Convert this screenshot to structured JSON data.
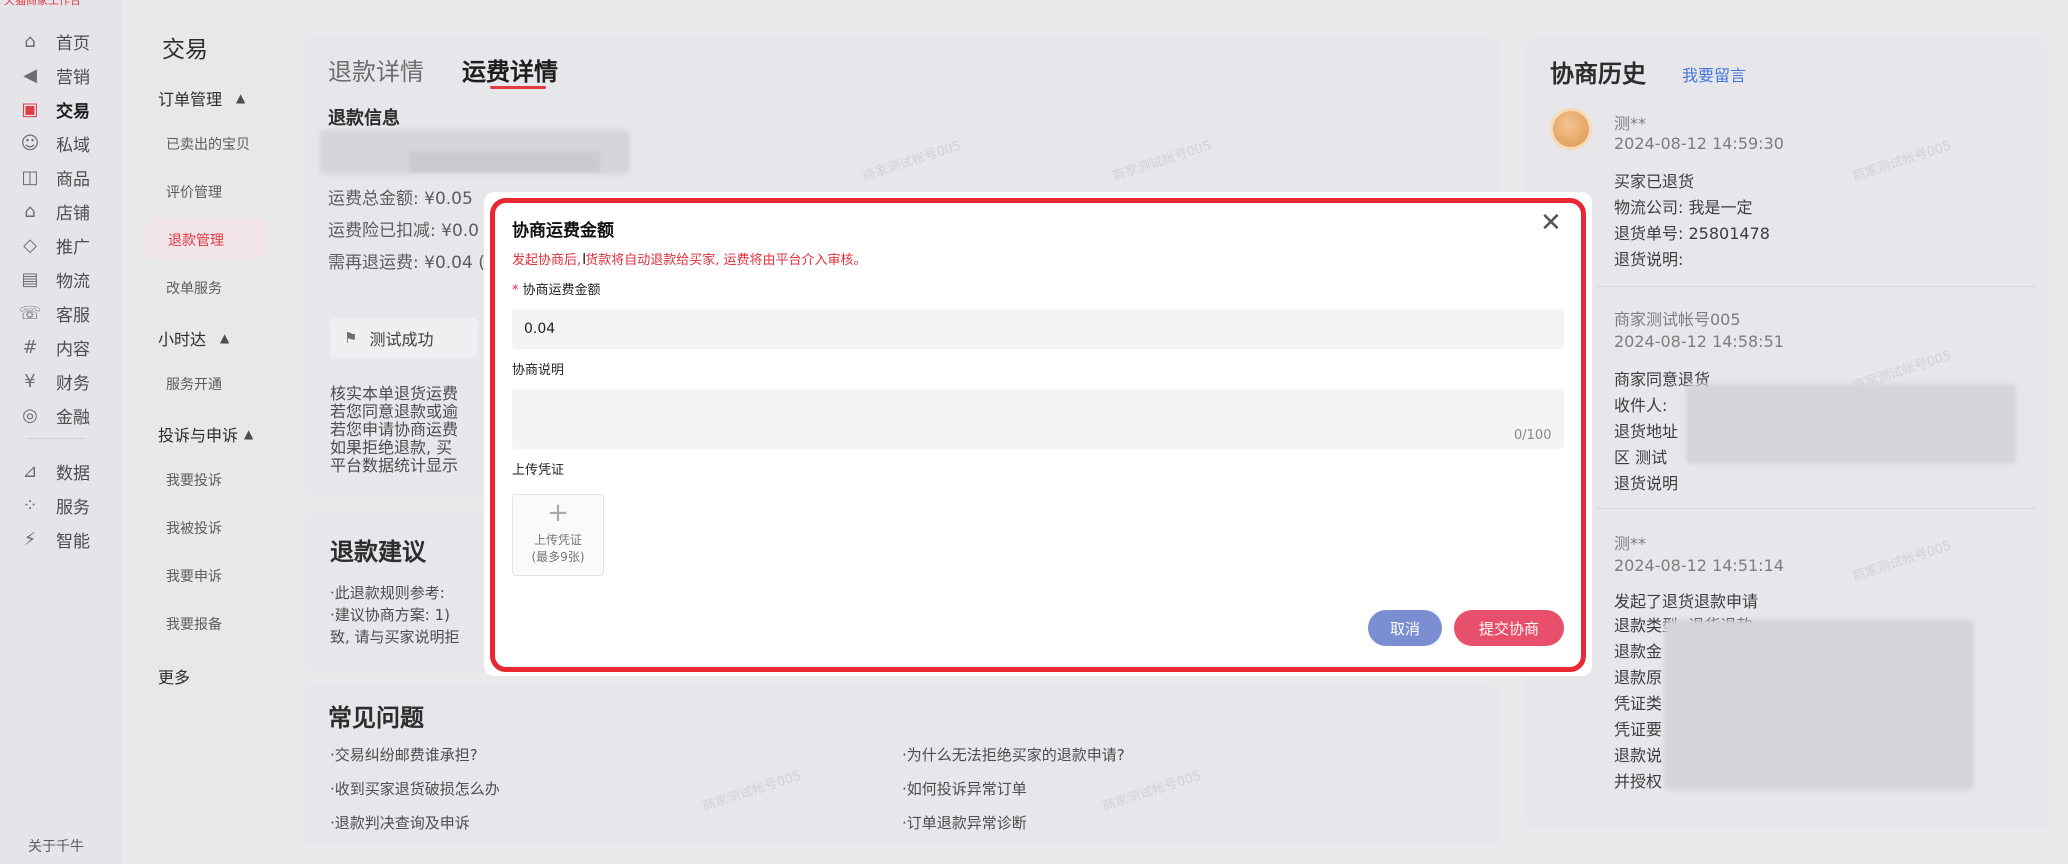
{
  "nav": {
    "top_text": "天猫商家工作台",
    "items": [
      {
        "label": "首页",
        "icon": "home-icon",
        "glyph": "⌂"
      },
      {
        "label": "营销",
        "icon": "megaphone-icon",
        "glyph": "📢"
      },
      {
        "label": "交易",
        "icon": "trade-icon",
        "glyph": "▣"
      },
      {
        "label": "私域",
        "icon": "people-icon",
        "glyph": "☺"
      },
      {
        "label": "商品",
        "icon": "product-icon",
        "glyph": "◫"
      },
      {
        "label": "店铺",
        "icon": "shop-icon",
        "glyph": "⌂"
      },
      {
        "label": "推广",
        "icon": "promote-icon",
        "glyph": "◇"
      },
      {
        "label": "物流",
        "icon": "truck-icon",
        "glyph": "⛟"
      },
      {
        "label": "客服",
        "icon": "headset-icon",
        "glyph": "☏"
      },
      {
        "label": "内容",
        "icon": "content-icon",
        "glyph": "#"
      },
      {
        "label": "财务",
        "icon": "yen-icon",
        "glyph": "¥"
      },
      {
        "label": "金融",
        "icon": "finance-icon",
        "glyph": "◎"
      },
      {
        "label": "数据",
        "icon": "chart-icon",
        "glyph": "⊿"
      },
      {
        "label": "服务",
        "icon": "grid-icon",
        "glyph": "⁘"
      },
      {
        "label": "智能",
        "icon": "bolt-icon",
        "glyph": "⚡"
      }
    ],
    "about": "关于千牛"
  },
  "subnav": {
    "title": "交易",
    "groups": [
      {
        "label": "订单管理",
        "items": [
          "已卖出的宝贝",
          "评价管理",
          "退款管理",
          "改单服务"
        ]
      },
      {
        "label": "小时达",
        "items": [
          "服务开通"
        ]
      },
      {
        "label": "投诉与申诉",
        "items": [
          "我要投诉",
          "我被投诉",
          "我要申诉",
          "我要报备"
        ]
      }
    ],
    "more": "更多"
  },
  "main": {
    "tab_refund": "退款详情",
    "tab_shipping": "运费详情",
    "section_title": "退款信息",
    "fee_total": "运费总金额: ¥0.05",
    "fee_deducted": "运费险已扣减: ¥0.0",
    "fee_refund": "需再退运费: ¥0.04 (",
    "status_badge": "测试成功",
    "notes": [
      "核实本单退货运费",
      "若您同意退款或逾",
      "若您申请协商运费",
      "如果拒绝退款, 买",
      "平台数据统计显示"
    ],
    "suggestion_title": "退款建议",
    "suggestion_lines": [
      "·此退款规则参考:",
      "·建议协商方案: 1)",
      "致, 请与买家说明拒"
    ],
    "faq_title": "常见问题",
    "faq_left": [
      "·交易纠纷邮费谁承担?",
      "·收到买家退货破损怎么办",
      "·退款判决查询及申诉"
    ],
    "faq_right": [
      "·为什么无法拒绝买家的退款申请?",
      "·如何投诉异常订单",
      "·订单退款异常诊断"
    ]
  },
  "history": {
    "title": "协商历史",
    "link": "我要留言",
    "entries": [
      {
        "name": "测**",
        "time": "2024-08-12 14:59:30",
        "lines": [
          "买家已退货",
          "物流公司: 我是一定",
          "退货单号: 25801478",
          "退货说明:"
        ]
      },
      {
        "name": "商家测试帐号005",
        "time": "2024-08-12 14:58:51",
        "lines": [
          "商家同意退货",
          "收件人:",
          "退货地址",
          "区  测试",
          "退货说明"
        ]
      },
      {
        "name": "测**",
        "time": "2024-08-12 14:51:14",
        "lines": [
          "发起了退货退款申请",
          "退款类型: 退货退款",
          "退款金",
          "退款原",
          "凭证类",
          "凭证要",
          "退款说",
          "并授权"
        ]
      }
    ]
  },
  "modal": {
    "title": "协商运费金额",
    "warning": "发起协商后, 货款将自动退款给买家, 运费将由平台介入审核。",
    "required_mark": "*",
    "amount_label": "协商运费金额",
    "amount_value": "0.04",
    "desc_label": "协商说明",
    "desc_count": "0/100",
    "upload_label": "上传凭证",
    "upload_btn_line1": "上传凭证",
    "upload_btn_line2": "(最多9张)",
    "cancel": "取消",
    "submit": "提交协商",
    "close_glyph": "✕",
    "accent_color": "#e0303c",
    "cancel_color": "#7c8ed2",
    "submit_color": "#e84f6a"
  },
  "watermark": "商家测试帐号005"
}
